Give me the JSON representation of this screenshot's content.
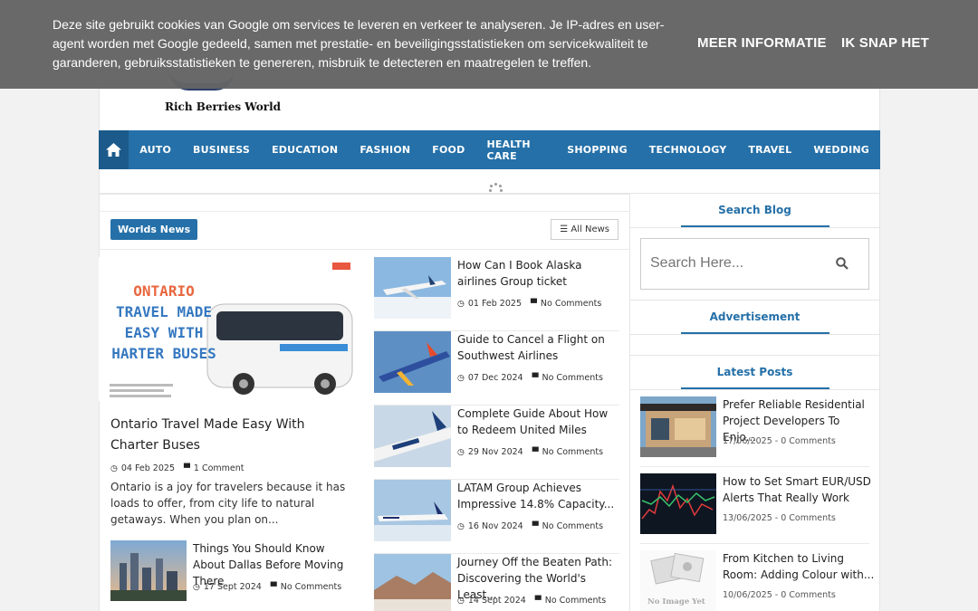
{
  "cookie": {
    "message": "Deze site gebruikt cookies van Google om services te leveren en verkeer te analyseren. Je IP-adres en user-agent worden met Google gedeeld, samen met prestatie- en beveiligingsstatistieken om servicekwaliteit te garanderen, gebruiksstatistieken te genereren, misbruik te detecteren en maatregelen te treffen.",
    "more_label": "MEER INFORMATIE",
    "ok_label": "IK SNAP HET"
  },
  "site": {
    "name": "Rich Berries World"
  },
  "nav": {
    "home_icon": "home-icon",
    "items": [
      "AUTO",
      "BUSINESS",
      "EDUCATION",
      "FASHION",
      "FOOD",
      "HEALTH CARE",
      "SHOPPING",
      "TECHNOLOGY",
      "TRAVEL",
      "WEDDING"
    ]
  },
  "section": {
    "badge": "Worlds News",
    "all_label": "All News"
  },
  "featured": {
    "image_text": [
      "ONTARIO",
      "TRAVEL MADE",
      "EASY WITH",
      "HARTER BUSES"
    ],
    "title": "Ontario Travel Made Easy With Charter Buses",
    "date": "04 Feb 2025",
    "comments": "1 Comment",
    "excerpt": "Ontario is a joy for travelers because it has loads to offer, from city life to natural getaways. When you plan on..."
  },
  "small_post": {
    "title": "Things You Should Know About Dallas Before Moving There",
    "date": "17 Sept 2024",
    "comments": "No Comments"
  },
  "list": [
    {
      "title": "How Can I Book Alaska airlines Group ticket",
      "date": "01 Feb 2025",
      "comments": "No Comments"
    },
    {
      "title": "Guide to Cancel a Flight on Southwest Airlines",
      "date": "07 Dec 2024",
      "comments": "No Comments"
    },
    {
      "title": "Complete Guide About How to Redeem United Miles",
      "date": "29 Nov 2024",
      "comments": "No Comments"
    },
    {
      "title": "LATAM Group Achieves Impressive 14.8% Capacity...",
      "date": "16 Nov 2024",
      "comments": "No Comments"
    },
    {
      "title": "Journey Off the Beaten Path: Discovering the World's Least...",
      "date": "14 Sept 2024",
      "comments": "No Comments"
    }
  ],
  "sidebar": {
    "search_title": "Search Blog",
    "search_placeholder": "Search Here...",
    "ad_title": "Advertisement",
    "latest_title": "Latest Posts",
    "latest": [
      {
        "title": "Prefer Reliable Residential Project Developers To Enjo...",
        "meta": "17/06/2025 - 0 Comments"
      },
      {
        "title": "How to Set Smart EUR/USD Alerts That Really Work",
        "meta": "13/06/2025 - 0 Comments"
      },
      {
        "title": "From Kitchen to Living Room: Adding Colour with...",
        "meta": "10/06/2025 - 0 Comments",
        "placeholder_text": "No Image Yet"
      }
    ]
  }
}
